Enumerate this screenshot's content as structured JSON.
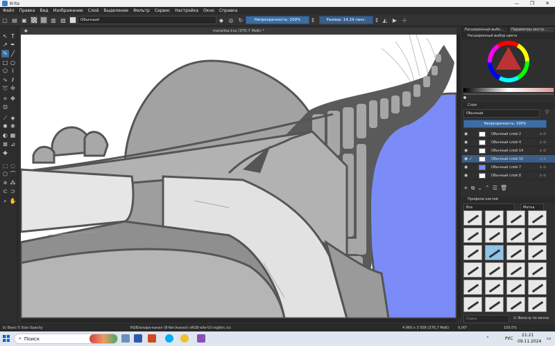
{
  "window": {
    "title": "Krita",
    "controls": [
      "—",
      "❐",
      "✕"
    ]
  },
  "menu": [
    "Файл",
    "Правка",
    "Вид",
    "Изображение",
    "Слой",
    "Выделение",
    "Фильтр",
    "Сервис",
    "Настройка",
    "Окно",
    "Справка"
  ],
  "toolbar": {
    "blend_mode": "Обычный",
    "opacity_label": "Непрозрачность: 100%",
    "size_label": "Размер: 14,19 пикс."
  },
  "canvas": {
    "title": "metalika.kra (376,7 МиБ) *"
  },
  "status": {
    "left": "b) Basic-5 Size Opacity",
    "color_space": "RGB/альфа-канал (8-бит/канал)  sRGB-elle-V2-srgbtrc.icc",
    "dimensions": "4 960 x 3 508 (376,7 МиБ)",
    "rotation": "0,00°",
    "zoom": "100,0%"
  },
  "dockers": {
    "tabs": [
      "Расширенный выбо...",
      "Параметры инстр..."
    ],
    "color_title": "Расширенный выбор цвета",
    "layers_title": "Слои",
    "layer_blend": "Обычный",
    "layer_opacity": "Непрозрачность: 100%",
    "layers": [
      {
        "name": "Обычный слой 2",
        "selected": false
      },
      {
        "name": "Обычный слой 4",
        "selected": false
      },
      {
        "name": "Обычный слой 14",
        "selected": false
      },
      {
        "name": "Обычный слой 16",
        "selected": true
      },
      {
        "name": "Обычный слой 7",
        "selected": false
      },
      {
        "name": "Обычный слой 8",
        "selected": false
      }
    ],
    "brushes_title": "Профили кистей",
    "brush_filter": "Все",
    "brush_tag": "Метка",
    "search_label": "Поиск",
    "filter_by_tag": "Фильтр по метке"
  },
  "taskbar": {
    "search_placeholder": "Поиск",
    "lang": "РУС",
    "time": "21:21",
    "date": "09.11.2024"
  },
  "colors": {
    "accent": "#3c6da3",
    "canvas_blue": "#7b8cf8",
    "gray_mid": "#9e9e9e",
    "outline": "#555555"
  }
}
